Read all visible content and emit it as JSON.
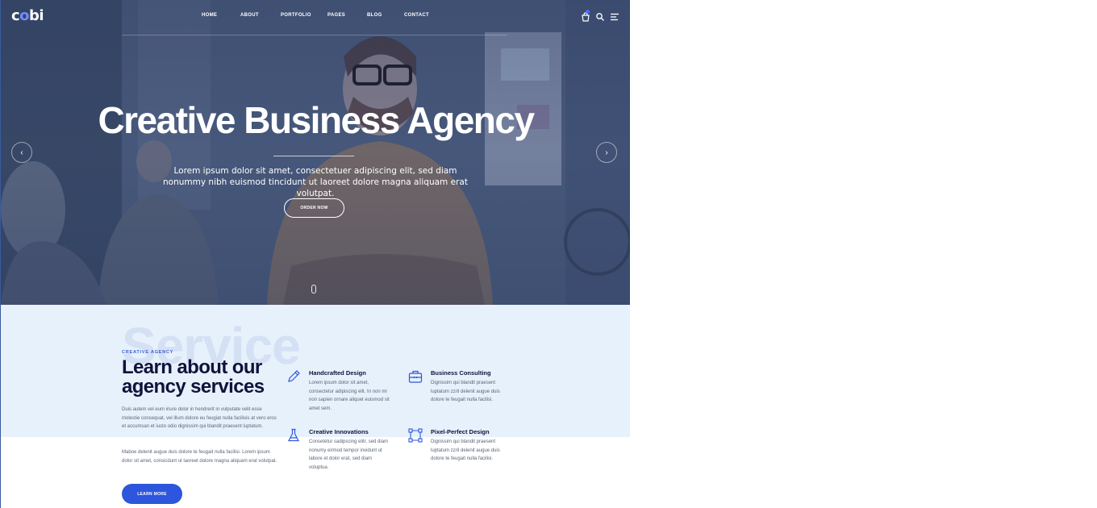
{
  "brand": {
    "logo_prefix": "c",
    "logo_dot": "o",
    "logo_suffix": "bi",
    "accent": "#2d56dd"
  },
  "nav": {
    "items": [
      "HOME",
      "ABOUT",
      "PORTFOLIO",
      "PAGES",
      "BLOG",
      "CONTACT"
    ]
  },
  "header_icons": [
    "cart-icon",
    "search-icon",
    "menu-icon"
  ],
  "hero": {
    "title": "Creative Business Agency",
    "subtitle": "Lorem ipsum dolor sit amet, consectetuer adipiscing elit, sed diam nonummy nibh euismod tincidunt ut laoreet dolore magna aliquam erat volutpat.",
    "button": "ORDER NOW",
    "prev_arrow": "‹",
    "next_arrow": "›"
  },
  "services": {
    "watermark": "Service",
    "eyebrow": "CREATIVE AGENCY",
    "title": "Learn about our agency services",
    "paragraph1": "Duis autem vel eum iriure dolor in hendrerit in vulputate velit esse molestie consequat, vel illum dolore eu feugiat nulla facilisis at vero eros et accumsan et iusto odio dignissim qui blandit praesent luptatum.",
    "paragraph2": "Maboe delenit augue duis dolore te feugait nulla facilisi. Lorem ipsum dolor sit amet, consicdunt ut laoreet dolore magna aliquam erat volutpat.",
    "button": "LEARN MORE",
    "items": [
      {
        "icon": "pencil-icon",
        "title": "Handcrafted Design",
        "text": "Lorem ipsum dolor sit amet, consectetur adipiscing elit. In non mi non sapien ornare aliquet euismod sit amet sem."
      },
      {
        "icon": "briefcase-icon",
        "title": "Business Consulting",
        "text": "Dignissim qui blandit praesent luptatum zzril delenit augue duis dolore te feugait nulla facilisi."
      },
      {
        "icon": "flask-icon",
        "title": "Creative Innovations",
        "text": "Consetetur sadipscing elitr, sed diam nonumy eirmod tempor invidunt ut labore et dolor erat, sed diam voluptua."
      },
      {
        "icon": "vector-nodes-icon",
        "title": "Pixel-Perfect Design",
        "text": "Dignissim qui blandit praesent luptatum zzril delenit augue duis dolore te feugait nulla facilisi."
      }
    ]
  }
}
